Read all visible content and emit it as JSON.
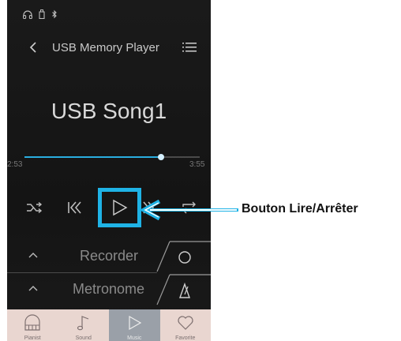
{
  "header": {
    "title": "USB Memory Player",
    "back_icon": "chevron-left-icon",
    "menu_icon": "list-icon"
  },
  "status_bar": {
    "icons": [
      "headphones-icon",
      "usb-icon",
      "bluetooth-icon"
    ]
  },
  "player": {
    "song_title": "USB Song1",
    "elapsed": "2:53",
    "total": "3:55",
    "progress": 0.78
  },
  "controls": {
    "shuffle_icon": "shuffle-icon",
    "previous_icon": "skip-previous-icon",
    "play_icon": "play-icon",
    "next_icon": "skip-next-icon",
    "repeat_icon": "repeat-icon"
  },
  "panels": {
    "recorder": {
      "label": "Recorder",
      "icon": "record-circle-icon"
    },
    "metronome": {
      "label": "Metronome",
      "icon": "metronome-icon"
    }
  },
  "bottom_nav": {
    "items": [
      {
        "label": "Pianist",
        "icon": "piano-icon",
        "active": false
      },
      {
        "label": "Sound",
        "icon": "music-note-icon",
        "active": false
      },
      {
        "label": "Music",
        "icon": "play-icon",
        "active": true
      },
      {
        "label": "Favorite",
        "icon": "heart-icon",
        "active": false
      }
    ]
  },
  "annotation": {
    "label": "Bouton Lire/Arrêter"
  },
  "colors": {
    "accent": "#1fb3e6",
    "background": "#161616",
    "nav_background": "#e9d6d0",
    "nav_active": "#9aa0a8"
  }
}
